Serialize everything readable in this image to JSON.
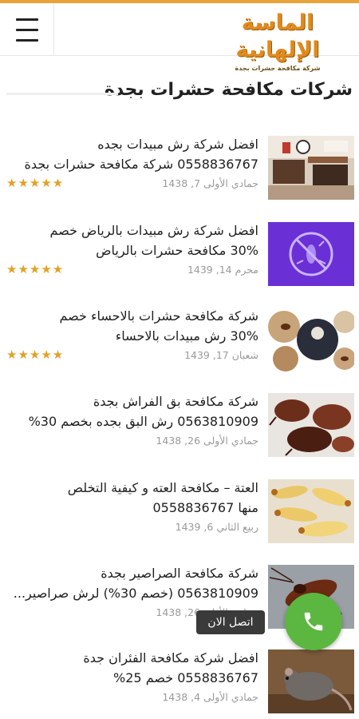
{
  "header": {
    "logo_title": "الماسة الإلهانية",
    "logo_subtitle": "شركة مكافحة حشرات بجدة"
  },
  "section": {
    "title": "شركات مكافحة حشرات بجدة"
  },
  "items": [
    {
      "title_line1": "افضل شركة رش مبيدات بجده",
      "title_line2": "0558836767 شركة مكافحة حشرات بجدة",
      "date": "جمادي الأولى 7, 1438",
      "rating": 5,
      "stars": "★★★★★",
      "thumb": "kitchen"
    },
    {
      "title_line1": "افضل شركة رش مبيدات بالرياض خصم",
      "title_line2": "30% مكافحة حشرات بالرياض",
      "date": "محرم 14, 1439",
      "rating": 5,
      "stars": "★★★★★",
      "thumb": "purple-bug"
    },
    {
      "title_line1": "شركة مكافحة حشرات بالاحساء خصم",
      "title_line2": "30% رش مبيدات بالاحساء",
      "date": "شعبان 17, 1439",
      "rating": 5,
      "stars": "★★★★★",
      "thumb": "collage"
    },
    {
      "title_line1": "شركة مكافحة بق الفراش بجدة",
      "title_line2": "0563810909 رش البق بجده بخصم 30%",
      "date": "جمادي الأولى 26, 1438",
      "thumb": "bedbugs"
    },
    {
      "title_line1": "العتة – مكافحة العته و كيفية التخلص",
      "title_line2": "منها 0558836767",
      "date": "ربيع الثاني 6, 1439",
      "thumb": "termites"
    },
    {
      "title_line1": "شركة مكافحة الصراصير بجدة",
      "title_line2": "0563810909 (خصم 30%) لرش صراصير...",
      "date": "جمادي الأولى 26, 1438",
      "thumb": "cockroach"
    },
    {
      "title_line1": "افضل شركة مكافحة الفئران جدة",
      "title_line2": "0558836767 خصم 25%",
      "date": "جمادي الأولى 4, 1438",
      "thumb": "mouse"
    }
  ],
  "call": {
    "label": "اتصل الان"
  },
  "colors": {
    "accent": "#e8a33a",
    "stars": "#e1a126",
    "call_button": "#5bb740"
  }
}
